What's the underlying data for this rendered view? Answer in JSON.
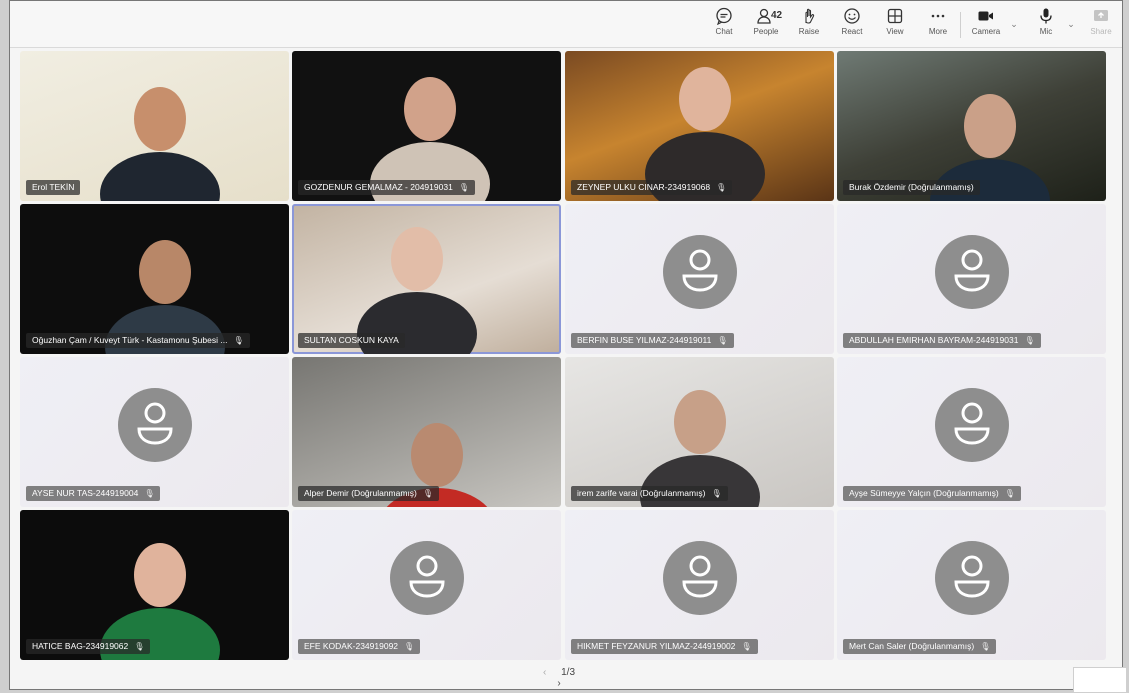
{
  "toolbar": {
    "chat": "Chat",
    "people": "People",
    "people_count": "42",
    "raise": "Raise",
    "react": "React",
    "view": "View",
    "more": "More",
    "camera": "Camera",
    "mic": "Mic",
    "share": "Share"
  },
  "participants": [
    {
      "name": "Erol TEKİN",
      "muted": false
    },
    {
      "name": "GOZDENUR GEMALMAZ - 204919031",
      "muted": true
    },
    {
      "name": "ZEYNEP ULKU CINAR-234919068",
      "muted": true
    },
    {
      "name": "Burak Özdemir (Doğrulanmamış)",
      "muted": false
    },
    {
      "name": "Oğuzhan Çam / Kuveyt Türk - Kastamonu Şubesi ...",
      "muted": true
    },
    {
      "name": "SULTAN COSKUN KAYA",
      "muted": false
    },
    {
      "name": "BERFIN BUSE YILMAZ-244919011",
      "muted": true
    },
    {
      "name": "ABDULLAH EMIRHAN BAYRAM-244919031",
      "muted": true
    },
    {
      "name": "AYSE NUR TAS-244919004",
      "muted": true
    },
    {
      "name": "Alper Demir (Doğrulanmamış)",
      "muted": true
    },
    {
      "name": "irem zarife varai (Doğrulanmamış)",
      "muted": true
    },
    {
      "name": "Ayşe Sümeyye Yalçın (Doğrulanmamış)",
      "muted": true
    },
    {
      "name": "HATICE BAG-234919062",
      "muted": true
    },
    {
      "name": "EFE KODAK-234919092",
      "muted": true
    },
    {
      "name": "HIKMET FEYZANUR YILMAZ-244919002",
      "muted": true
    },
    {
      "name": "Mert Can Saler (Doğrulanmamış)",
      "muted": true
    }
  ],
  "pager": {
    "page": "1/3"
  }
}
